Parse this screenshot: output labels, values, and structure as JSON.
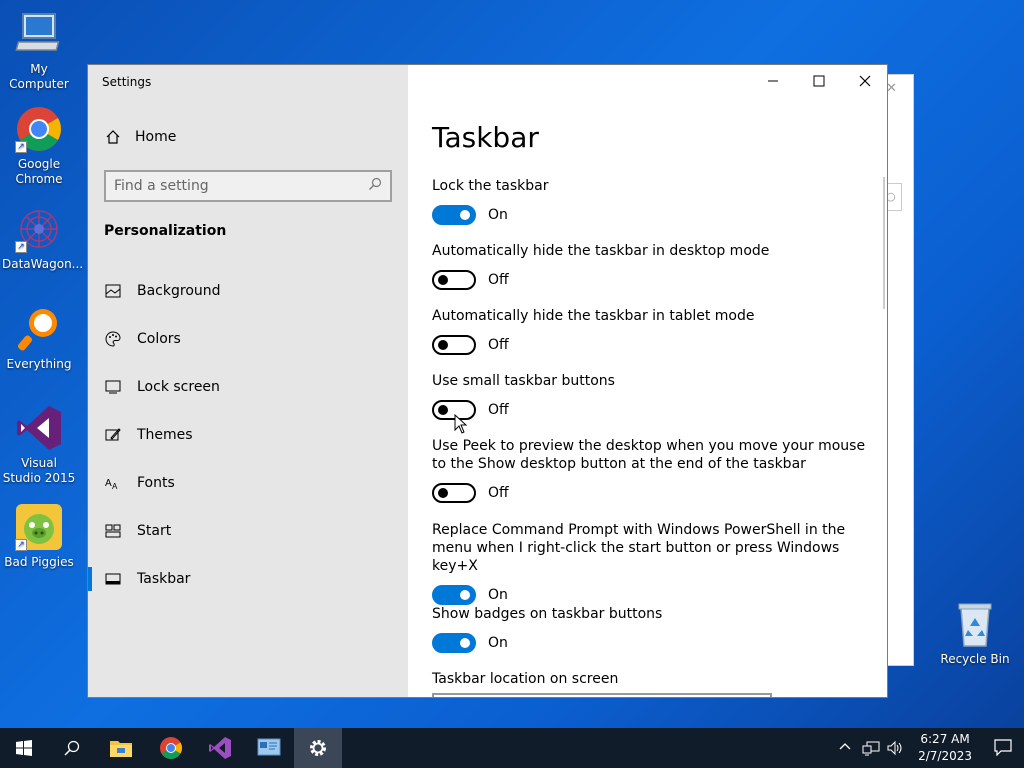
{
  "desktop": {
    "icons": [
      {
        "label": "My Computer"
      },
      {
        "label": "Google Chrome"
      },
      {
        "label": "DataWagon..."
      },
      {
        "label": "Everything"
      },
      {
        "label": "Visual Studio 2015"
      },
      {
        "label": "Bad Piggies"
      },
      {
        "label": "Recycle Bin"
      }
    ]
  },
  "window": {
    "title": "Settings",
    "controls": {
      "minimize": "–",
      "maximize": "□",
      "close": "✕"
    }
  },
  "sidebar": {
    "home_label": "Home",
    "search_placeholder": "Find a setting",
    "section_title": "Personalization",
    "items": [
      {
        "label": "Background",
        "icon": "picture-icon"
      },
      {
        "label": "Colors",
        "icon": "palette-icon"
      },
      {
        "label": "Lock screen",
        "icon": "lock-screen-icon"
      },
      {
        "label": "Themes",
        "icon": "themes-icon"
      },
      {
        "label": "Fonts",
        "icon": "fonts-icon"
      },
      {
        "label": "Start",
        "icon": "start-icon"
      },
      {
        "label": "Taskbar",
        "icon": "taskbar-icon",
        "selected": true
      }
    ]
  },
  "main": {
    "title": "Taskbar",
    "settings": [
      {
        "label": "Lock the taskbar",
        "state": "On",
        "on": true
      },
      {
        "label": "Automatically hide the taskbar in desktop mode",
        "state": "Off",
        "on": false
      },
      {
        "label": "Automatically hide the taskbar in tablet mode",
        "state": "Off",
        "on": false
      },
      {
        "label": "Use small taskbar buttons",
        "state": "Off",
        "on": false
      },
      {
        "label": "Use Peek to preview the desktop when you move your mouse to the Show desktop button at the end of the taskbar",
        "state": "Off",
        "on": false
      },
      {
        "label": "Replace Command Prompt with Windows PowerShell in the menu when I right-click the start button or press Windows key+X",
        "state": "On",
        "on": true
      },
      {
        "label": "Show badges on taskbar buttons",
        "state": "On",
        "on": true
      }
    ],
    "location_label": "Taskbar location on screen"
  },
  "taskbar": {
    "time": "6:27 AM",
    "date": "2/7/2023"
  },
  "colors": {
    "accent": "#0078d7",
    "sidebar_bg": "#e6e6e6",
    "taskbar_bg": "#101c2a"
  }
}
